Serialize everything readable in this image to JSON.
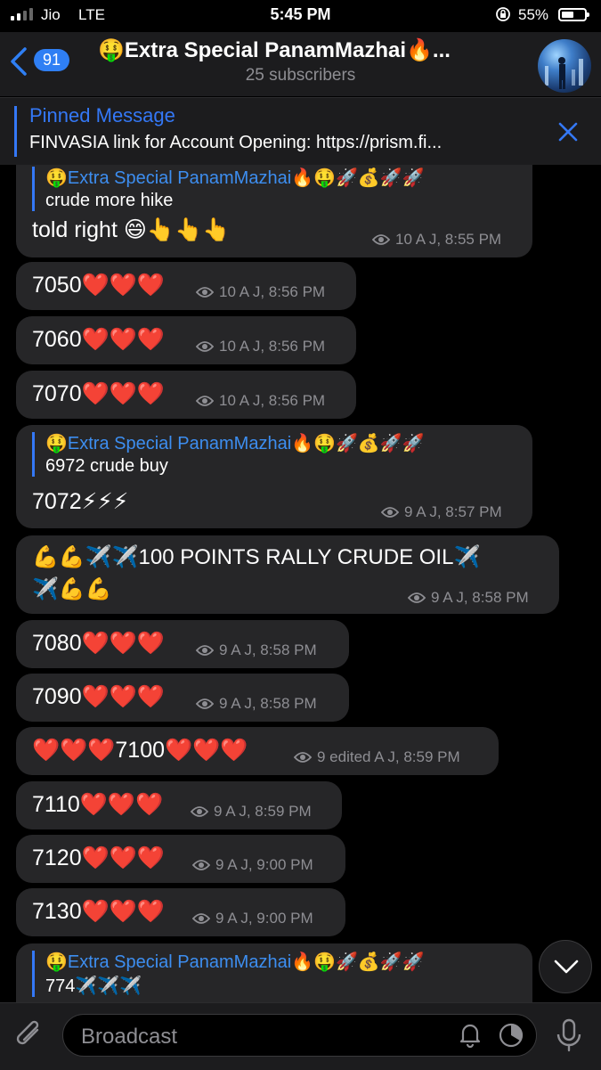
{
  "status_bar": {
    "carrier": "Jio",
    "network": "LTE",
    "time": "5:45 PM",
    "battery_pct": "55%",
    "battery_level": 0.55
  },
  "header": {
    "back_count": "91",
    "title": "🤑Extra Special PanamMazhai🔥...",
    "subtitle": "25 subscribers",
    "avatar_icon": "channel-avatar"
  },
  "pinned": {
    "title": "Pinned Message",
    "text": "FINVASIA link for Account Opening: https://prism.fi..."
  },
  "messages": [
    {
      "reply_name": "🤑Extra Special PanamMazhai🔥🤑🚀💰🚀🚀",
      "reply_text": "crude more hike",
      "text": "told right 😄👆👆👆",
      "meta": "10 A J, 8:55 PM"
    },
    {
      "text": "7050❤️❤️❤️",
      "meta": "10 A J, 8:56 PM"
    },
    {
      "text": "7060❤️❤️❤️",
      "meta": "10 A J, 8:56 PM"
    },
    {
      "text": "7070❤️❤️❤️",
      "meta": "10 A J, 8:56 PM"
    },
    {
      "reply_name": "🤑Extra Special PanamMazhai🔥🤑🚀💰🚀🚀",
      "reply_text": "6972 crude buy",
      "text": "7072⚡⚡⚡",
      "meta": "9 A J, 8:57 PM"
    },
    {
      "text": "💪💪✈️✈️100 POINTS RALLY CRUDE OIL✈️",
      "text2": "✈️💪💪",
      "meta": "9 A J, 8:58 PM"
    },
    {
      "text": "7080❤️❤️❤️",
      "meta": "9 A J, 8:58 PM"
    },
    {
      "text": "7090❤️❤️❤️",
      "meta": "9 A J, 8:58 PM"
    },
    {
      "text": "❤️❤️❤️7100❤️❤️❤️",
      "meta": "9 edited A J, 8:59 PM"
    },
    {
      "text": "7110❤️❤️❤️",
      "meta": "9 A J, 8:59 PM"
    },
    {
      "text": "7120❤️❤️❤️",
      "meta": "9 A J, 9:00 PM"
    },
    {
      "text": "7130❤️❤️❤️",
      "meta": "9 A J, 9:00 PM"
    },
    {
      "reply_name": "🤑Extra Special PanamMazhai🔥🤑🚀💰🚀🚀",
      "reply_text": "774✈️✈️✈️"
    }
  ],
  "input": {
    "placeholder": "Broadcast"
  },
  "colors": {
    "accent": "#3478f6",
    "bubble": "#262628",
    "background": "#000000",
    "muted": "#8e8e93"
  }
}
